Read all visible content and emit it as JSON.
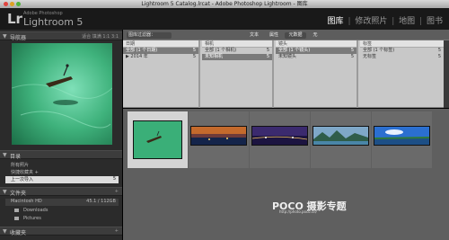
{
  "titlebar": {
    "title": "Lightroom 5 Catalog.lrcat - Adobe Photoshop Lightroom - 图库"
  },
  "identity": {
    "logo": "Lr",
    "vendor": "Adobe Photoshop",
    "product": "Lightroom 5"
  },
  "modules": {
    "items": [
      "图库",
      "修改照片",
      "地图",
      "图书"
    ],
    "active": "图库"
  },
  "navigator": {
    "title": "导航器",
    "zoom_options": [
      "适合",
      "填满",
      "1:1",
      "3:1"
    ]
  },
  "catalog": {
    "title": "目录",
    "items": [
      {
        "label": "所有照片",
        "count": ""
      },
      {
        "label": "快捷收藏夹 +",
        "count": ""
      },
      {
        "label": "上一次导入",
        "count": "5"
      }
    ]
  },
  "folders": {
    "title": "文件夹",
    "drive": {
      "label": "Macintosh HD",
      "value": "45.1 / 112GB"
    },
    "items": [
      {
        "label": "Downloads",
        "count": ""
      },
      {
        "label": "Pictures",
        "count": ""
      }
    ]
  },
  "collections": {
    "title": "收藏夹"
  },
  "filter_bar": {
    "title": "图库过滤器：",
    "tabs": [
      "文本",
      "属性",
      "元数据",
      "无"
    ],
    "active": "元数据"
  },
  "metadata_browser": {
    "columns": [
      {
        "header": "日期",
        "items": [
          {
            "label": "全部 (1 个日期)",
            "count": "5",
            "selected": true
          },
          {
            "label": "▶ 2014 年",
            "count": "5",
            "selected": false
          }
        ]
      },
      {
        "header": "相机",
        "items": [
          {
            "label": "全部 (1 个相机)",
            "count": "5",
            "selected": false
          },
          {
            "label": "未知相机",
            "count": "5",
            "selected": true
          }
        ]
      },
      {
        "header": "镜头",
        "items": [
          {
            "label": "全部 (1 个镜头)",
            "count": "5",
            "selected": true
          },
          {
            "label": "未知镜头",
            "count": "5",
            "selected": false
          }
        ]
      },
      {
        "header": "标签",
        "items": [
          {
            "label": "全部 (1 个标签)",
            "count": "5",
            "selected": false
          },
          {
            "label": "无标签",
            "count": "5",
            "selected": false
          }
        ]
      }
    ]
  },
  "grid": {
    "thumbnails": [
      "boat-lagoon",
      "city-sunset",
      "city-night-purple",
      "karst-mountains",
      "blue-sky-lake"
    ],
    "selected_index": 0
  },
  "watermark": {
    "brand": "POCO 摄影专题",
    "url": "http://photo.poco.cn/"
  },
  "colors": {
    "panel_bg": "#2b2b2b",
    "grid_bg": "#5f5f5f",
    "browser_bg": "#c8c8c8",
    "active_module": "#ffffff"
  }
}
